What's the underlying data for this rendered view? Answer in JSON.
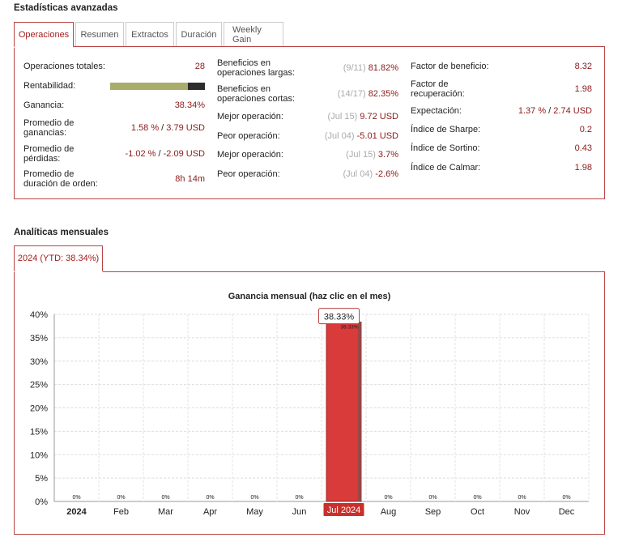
{
  "advanced": {
    "title": "Estadísticas avanzadas",
    "tabs": [
      "Operaciones",
      "Resumen",
      "Extractos",
      "Duración",
      "Weekly Gain"
    ],
    "col1": [
      {
        "label": "Operaciones totales:",
        "value": "28"
      },
      {
        "label": "Rentabilidad:",
        "bar_fraction": 0.82
      },
      {
        "label": "Ganancia:",
        "value": "38.34%"
      },
      {
        "label": "Promedio de ganancias:",
        "value_a": "1.58 %",
        "sep": " / ",
        "value_b": "3.79 USD"
      },
      {
        "label": "Promedio de pérdidas:",
        "value_a": "-1.02 %",
        "sep": " / ",
        "value_b": "-2.09 USD"
      },
      {
        "label": "Promedio de duración de orden:",
        "value": "8h 14m"
      }
    ],
    "col2": [
      {
        "label": "Beneficios en operaciones largas:",
        "muted": "(9/11)",
        "value": "81.82%"
      },
      {
        "label": "Beneficios en operaciones cortas:",
        "muted": "(14/17)",
        "value": "82.35%"
      },
      {
        "label": "Mejor operación:",
        "muted": "(Jul 15)",
        "value": "9.72 USD"
      },
      {
        "label": "Peor operación:",
        "muted": "(Jul 04)",
        "value": "-5.01 USD"
      },
      {
        "label": "Mejor operación:",
        "muted": "(Jul 15)",
        "value": "3.7%"
      },
      {
        "label": "Peor operación:",
        "muted": "(Jul 04)",
        "value": "-2.6%"
      }
    ],
    "col3": [
      {
        "label": "Factor de beneficio:",
        "value": "8.32"
      },
      {
        "label": "Factor de recuperación:",
        "value": "1.98"
      },
      {
        "label": "Expectación:",
        "value_a": "1.37 %",
        "sep": " / ",
        "value_b": "2.74 USD"
      },
      {
        "label": "Índice de Sharpe:",
        "value": "0.2"
      },
      {
        "label": "Índice de Sortino:",
        "value": "0.43"
      },
      {
        "label": "Índice de Calmar:",
        "value": "1.98"
      }
    ]
  },
  "monthly": {
    "title": "Analíticas mensuales",
    "tab": "2024 (YTD: 38.34%)",
    "colors": {
      "bar": "#d93a3a",
      "bar_stroke": "#a32424",
      "label_bg": "#c9302c"
    }
  },
  "chart_data": {
    "type": "bar",
    "title": "Ganancia mensual (haz clic en el mes)",
    "categories": [
      "2024",
      "Feb",
      "Mar",
      "Apr",
      "May",
      "Jun",
      "Jul",
      "Aug",
      "Sep",
      "Oct",
      "Nov",
      "Dec"
    ],
    "values": [
      0,
      0,
      0,
      0,
      0,
      0,
      38.33,
      0,
      0,
      0,
      0,
      0
    ],
    "value_labels": [
      "0%",
      "0%",
      "0%",
      "0%",
      "0%",
      "0%",
      "38.33%",
      "0%",
      "0%",
      "0%",
      "0%",
      "0%"
    ],
    "yticks": [
      "0%",
      "5%",
      "10%",
      "15%",
      "20%",
      "25%",
      "30%",
      "35%",
      "40%"
    ],
    "ylim": [
      0,
      40
    ],
    "highlight_index": 6,
    "highlight_label": "Jul 2024",
    "tooltip": "38.33%",
    "grid": true
  }
}
